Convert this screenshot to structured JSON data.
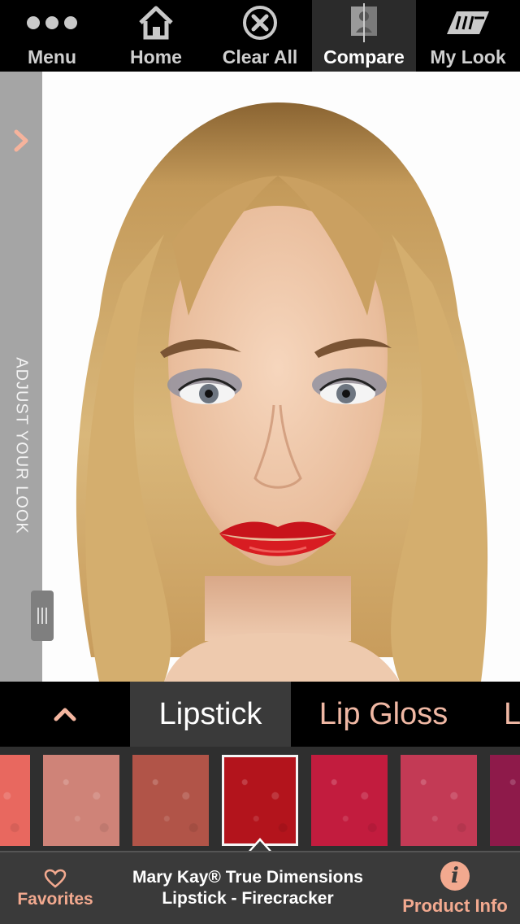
{
  "topbar": {
    "items": [
      {
        "label": "Menu",
        "icon": "more-dots-icon"
      },
      {
        "label": "Home",
        "icon": "home-icon"
      },
      {
        "label": "Clear All",
        "icon": "clear-circle-x-icon"
      },
      {
        "label": "Compare",
        "icon": "compare-split-face-icon",
        "active": true
      },
      {
        "label": "My Look",
        "icon": "my-look-brand-icon"
      }
    ]
  },
  "side_panel": {
    "label": "ADJUST YOUR LOOK",
    "icon": "chevron-right-icon"
  },
  "photo": {
    "subject": "model-face-makeover",
    "lip_color": "#d3161d"
  },
  "categories": {
    "collapse_icon": "chevron-up-icon",
    "tabs": [
      {
        "label": "Lipstick",
        "active": true
      },
      {
        "label": "Lip Gloss"
      },
      {
        "label": "L"
      }
    ]
  },
  "swatches": {
    "colors": [
      "#e8685f",
      "#cf8378",
      "#b15448",
      "#b3141c",
      "#c21c3e",
      "#c33a55",
      "#8e1a4a"
    ],
    "selected_index": 3
  },
  "bottombar": {
    "favorites_label": "Favorites",
    "favorites_icon": "heart-outline-icon",
    "product_line1": "Mary Kay® True Dimensions",
    "product_line2": "Lipstick - Firecracker",
    "info_icon": "info-icon",
    "info_glyph": "i",
    "info_label": "Product Info"
  },
  "colors": {
    "accent": "#f2a98f",
    "bar_bg": "#3a3a3a",
    "side_panel_bg": "#a5a5a5"
  }
}
